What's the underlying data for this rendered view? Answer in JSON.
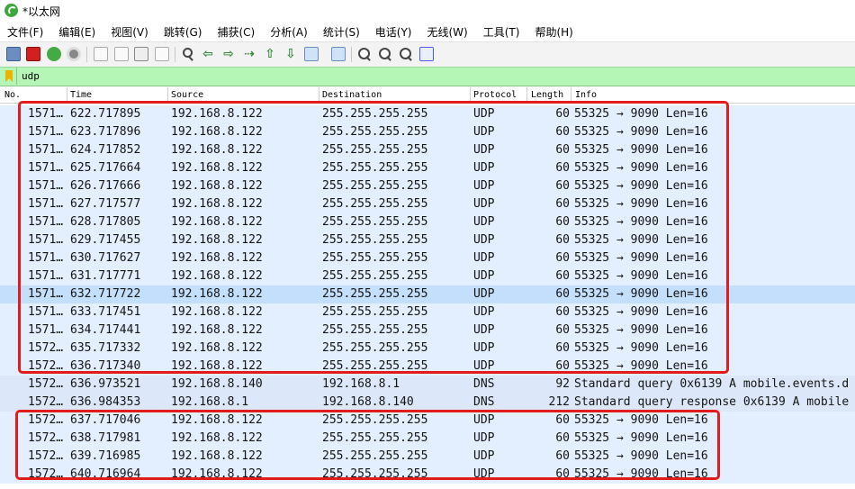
{
  "window": {
    "title": "*以太网"
  },
  "menu": [
    "文件(F)",
    "编辑(E)",
    "视图(V)",
    "跳转(G)",
    "捕获(C)",
    "分析(A)",
    "统计(S)",
    "电话(Y)",
    "无线(W)",
    "工具(T)",
    "帮助(H)"
  ],
  "toolbar": {
    "icons": [
      "shark-fin-start-icon",
      "stop-square-icon",
      "restart-capture-icon",
      "capture-options-gear-icon",
      "open-file-icon",
      "save-file-icon",
      "close-file-icon",
      "reload-file-icon",
      "find-packet-icon",
      "go-back-arrow-icon",
      "go-forward-arrow-icon",
      "go-to-packet-icon",
      "go-first-packet-icon",
      "go-last-packet-icon",
      "auto-scroll-icon",
      "colorize-icon",
      "zoom-in-icon",
      "zoom-out-icon",
      "normal-size-icon",
      "resize-columns-icon"
    ]
  },
  "filter": {
    "value": "udp"
  },
  "columns": {
    "no": "No.",
    "time": "Time",
    "source": "Source",
    "destination": "Destination",
    "protocol": "Protocol",
    "length": "Length",
    "info": "Info"
  },
  "packets": [
    {
      "no": "1571…",
      "time": "622.717895",
      "src": "192.168.8.122",
      "dst": "255.255.255.255",
      "proto": "UDP",
      "len": "60",
      "info": "55325 → 9090 Len=16",
      "type": "udp"
    },
    {
      "no": "1571…",
      "time": "623.717896",
      "src": "192.168.8.122",
      "dst": "255.255.255.255",
      "proto": "UDP",
      "len": "60",
      "info": "55325 → 9090 Len=16",
      "type": "udp"
    },
    {
      "no": "1571…",
      "time": "624.717852",
      "src": "192.168.8.122",
      "dst": "255.255.255.255",
      "proto": "UDP",
      "len": "60",
      "info": "55325 → 9090 Len=16",
      "type": "udp"
    },
    {
      "no": "1571…",
      "time": "625.717664",
      "src": "192.168.8.122",
      "dst": "255.255.255.255",
      "proto": "UDP",
      "len": "60",
      "info": "55325 → 9090 Len=16",
      "type": "udp"
    },
    {
      "no": "1571…",
      "time": "626.717666",
      "src": "192.168.8.122",
      "dst": "255.255.255.255",
      "proto": "UDP",
      "len": "60",
      "info": "55325 → 9090 Len=16",
      "type": "udp"
    },
    {
      "no": "1571…",
      "time": "627.717577",
      "src": "192.168.8.122",
      "dst": "255.255.255.255",
      "proto": "UDP",
      "len": "60",
      "info": "55325 → 9090 Len=16",
      "type": "udp"
    },
    {
      "no": "1571…",
      "time": "628.717805",
      "src": "192.168.8.122",
      "dst": "255.255.255.255",
      "proto": "UDP",
      "len": "60",
      "info": "55325 → 9090 Len=16",
      "type": "udp"
    },
    {
      "no": "1571…",
      "time": "629.717455",
      "src": "192.168.8.122",
      "dst": "255.255.255.255",
      "proto": "UDP",
      "len": "60",
      "info": "55325 → 9090 Len=16",
      "type": "udp"
    },
    {
      "no": "1571…",
      "time": "630.717627",
      "src": "192.168.8.122",
      "dst": "255.255.255.255",
      "proto": "UDP",
      "len": "60",
      "info": "55325 → 9090 Len=16",
      "type": "udp"
    },
    {
      "no": "1571…",
      "time": "631.717771",
      "src": "192.168.8.122",
      "dst": "255.255.255.255",
      "proto": "UDP",
      "len": "60",
      "info": "55325 → 9090 Len=16",
      "type": "udp"
    },
    {
      "no": "1571…",
      "time": "632.717722",
      "src": "192.168.8.122",
      "dst": "255.255.255.255",
      "proto": "UDP",
      "len": "60",
      "info": "55325 → 9090 Len=16",
      "type": "udp",
      "selected": true
    },
    {
      "no": "1571…",
      "time": "633.717451",
      "src": "192.168.8.122",
      "dst": "255.255.255.255",
      "proto": "UDP",
      "len": "60",
      "info": "55325 → 9090 Len=16",
      "type": "udp"
    },
    {
      "no": "1571…",
      "time": "634.717441",
      "src": "192.168.8.122",
      "dst": "255.255.255.255",
      "proto": "UDP",
      "len": "60",
      "info": "55325 → 9090 Len=16",
      "type": "udp"
    },
    {
      "no": "1572…",
      "time": "635.717332",
      "src": "192.168.8.122",
      "dst": "255.255.255.255",
      "proto": "UDP",
      "len": "60",
      "info": "55325 → 9090 Len=16",
      "type": "udp"
    },
    {
      "no": "1572…",
      "time": "636.717340",
      "src": "192.168.8.122",
      "dst": "255.255.255.255",
      "proto": "UDP",
      "len": "60",
      "info": "55325 → 9090 Len=16",
      "type": "udp"
    },
    {
      "no": "1572…",
      "time": "636.973521",
      "src": "192.168.8.140",
      "dst": "192.168.8.1",
      "proto": "DNS",
      "len": "92",
      "info": "Standard query 0x6139 A mobile.events.d",
      "type": "dns"
    },
    {
      "no": "1572…",
      "time": "636.984353",
      "src": "192.168.8.1",
      "dst": "192.168.8.140",
      "proto": "DNS",
      "len": "212",
      "info": "Standard query response 0x6139 A mobile",
      "type": "dns"
    },
    {
      "no": "1572…",
      "time": "637.717046",
      "src": "192.168.8.122",
      "dst": "255.255.255.255",
      "proto": "UDP",
      "len": "60",
      "info": "55325 → 9090 Len=16",
      "type": "udp"
    },
    {
      "no": "1572…",
      "time": "638.717981",
      "src": "192.168.8.122",
      "dst": "255.255.255.255",
      "proto": "UDP",
      "len": "60",
      "info": "55325 → 9090 Len=16",
      "type": "udp"
    },
    {
      "no": "1572…",
      "time": "639.716985",
      "src": "192.168.8.122",
      "dst": "255.255.255.255",
      "proto": "UDP",
      "len": "60",
      "info": "55325 → 9090 Len=16",
      "type": "udp"
    },
    {
      "no": "1572…",
      "time": "640.716964",
      "src": "192.168.8.122",
      "dst": "255.255.255.255",
      "proto": "UDP",
      "len": "60",
      "info": "55325 → 9090 Len=16",
      "type": "udp"
    }
  ],
  "colors": {
    "udp_row": "#e3eefe",
    "selected_row": "#c4dffb",
    "filter_ok": "#b5f5b5",
    "annotation": "#e21c1c"
  }
}
